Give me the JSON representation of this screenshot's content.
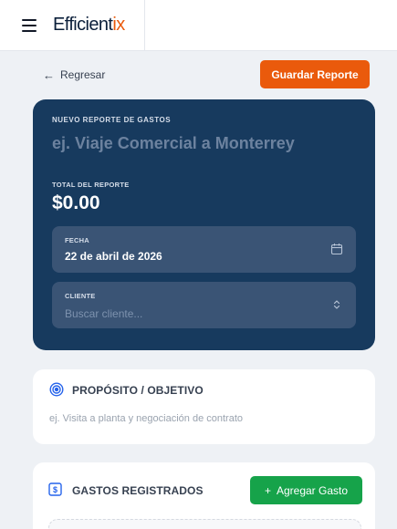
{
  "header": {
    "brand_main": "Efficient",
    "brand_accent": "ix"
  },
  "nav": {
    "back_label": "Regresar",
    "save_label": "Guardar Reporte"
  },
  "report": {
    "eyebrow": "NUEVO REPORTE DE GASTOS",
    "title_placeholder": "ej. Viaje Comercial a Monterrey",
    "total_label": "TOTAL DEL REPORTE",
    "total_value": "$0.00",
    "date_label": "FECHA",
    "date_value": "22 de abril de 2026",
    "client_label": "CLIENTE",
    "client_placeholder": "Buscar cliente..."
  },
  "purpose": {
    "title": "PROPÓSITO / OBJETIVO",
    "placeholder": "ej. Visita a planta y negociación de contrato"
  },
  "expenses": {
    "title": "GASTOS REGISTRADOS",
    "add_label": "Agregar Gasto"
  },
  "colors": {
    "accent": "#ea5a0c",
    "hero_bg": "#173a5e",
    "success": "#16a34a"
  },
  "icons": [
    "menu-icon",
    "arrow-left-icon",
    "calendar-icon",
    "chevron-updown-icon",
    "target-icon",
    "dollar-icon",
    "plus-icon"
  ]
}
